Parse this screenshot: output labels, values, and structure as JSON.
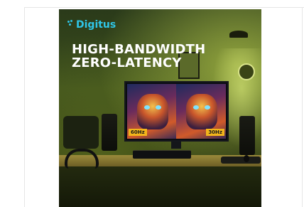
{
  "image": {
    "brand": "Digitus",
    "headline_line1": "HIGH-BANDWIDTH",
    "headline_line2": "ZERO-LATENCY",
    "left_refresh_label": "60Hz",
    "right_refresh_label": "30Hz"
  },
  "colors": {
    "brand_accent": "#2fc6e8",
    "badge": "#f3b51b",
    "headline": "#ffffff"
  }
}
